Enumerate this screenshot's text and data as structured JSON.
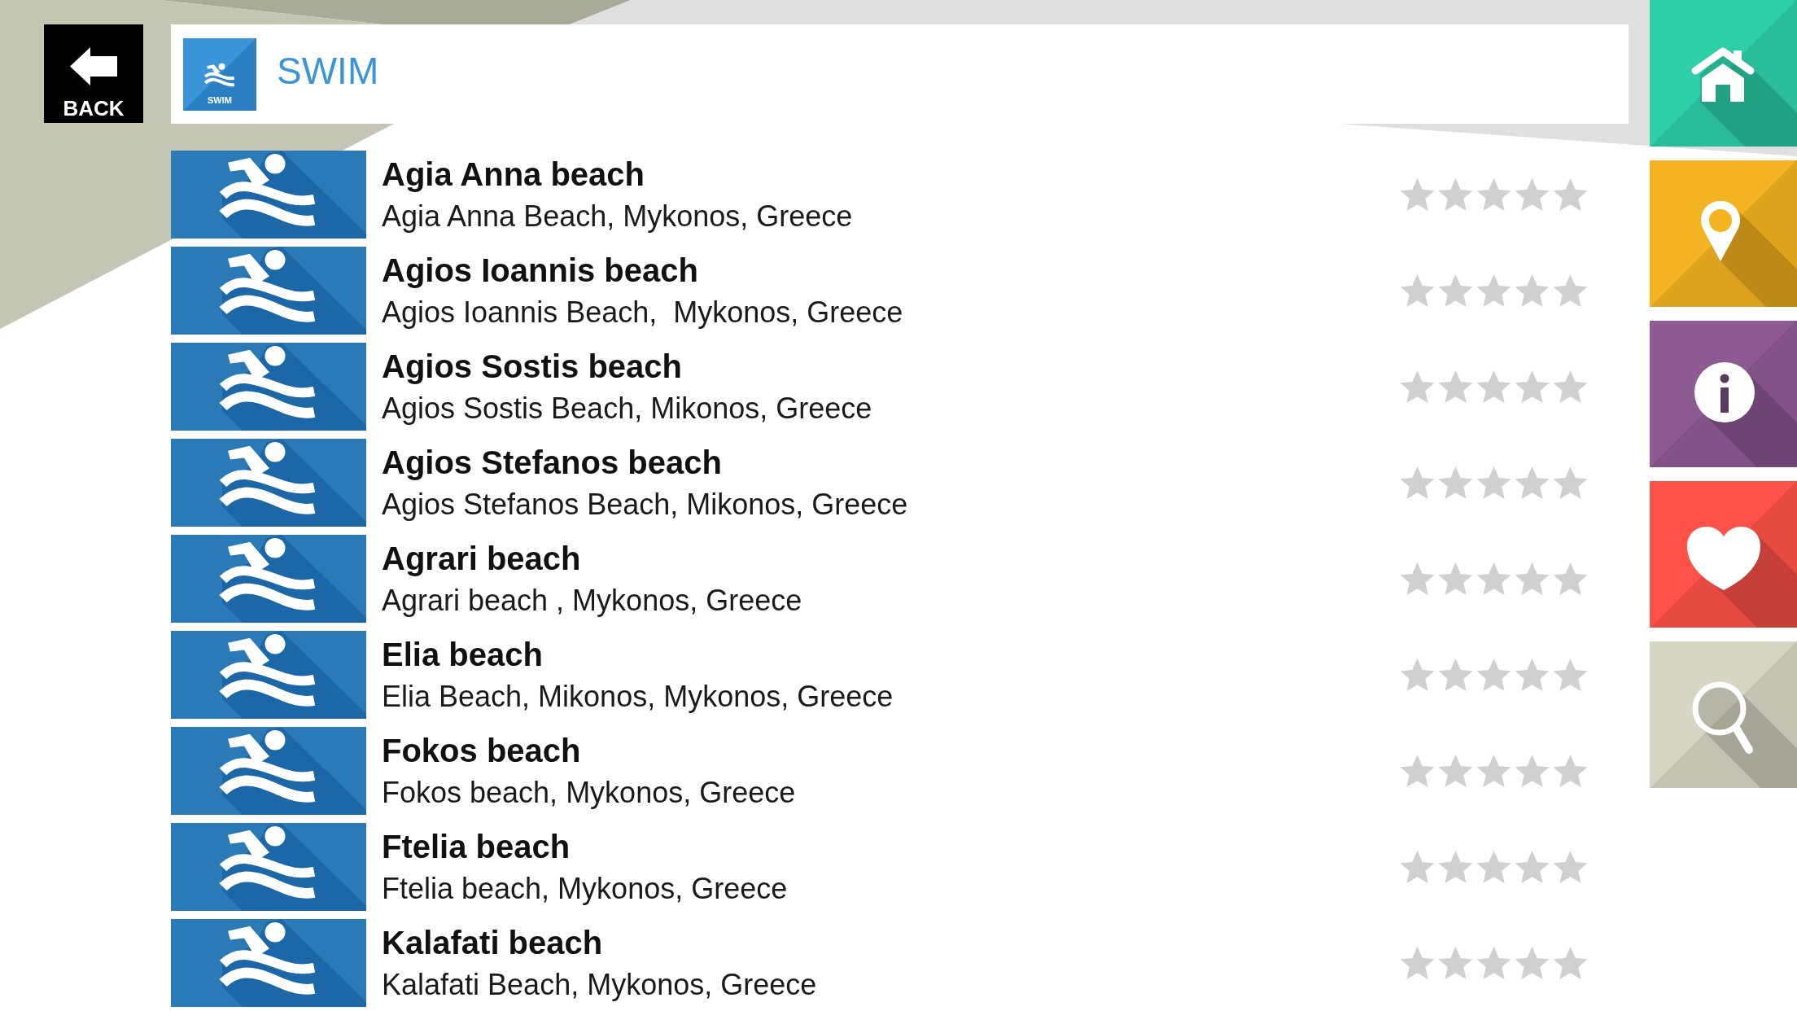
{
  "back_button": {
    "label": "BACK"
  },
  "header": {
    "icon_label": "SWIM",
    "title": "SWIM"
  },
  "places": [
    {
      "name": "Agia Anna beach",
      "address": "Agia Anna Beach, Mykonos, Greece",
      "stars": 0
    },
    {
      "name": "Agios Ioannis beach",
      "address": "Agios Ioannis Beach,  Mykonos, Greece",
      "stars": 0
    },
    {
      "name": "Agios Sostis beach",
      "address": "Agios Sostis Beach, Mikonos, Greece",
      "stars": 0
    },
    {
      "name": "Agios Stefanos beach",
      "address": "Agios Stefanos Beach, Mikonos, Greece",
      "stars": 0
    },
    {
      "name": "Agrari beach",
      "address": "Agrari beach , Mykonos, Greece",
      "stars": 0
    },
    {
      "name": "Elia beach",
      "address": "Elia Beach, Mikonos, Mykonos, Greece",
      "stars": 0
    },
    {
      "name": "Fokos beach",
      "address": "Fokos beach, Mykonos, Greece",
      "stars": 0
    },
    {
      "name": "Ftelia beach",
      "address": "Ftelia beach, Mykonos, Greece",
      "stars": 0
    },
    {
      "name": "Kalafati beach",
      "address": "Kalafati Beach, Mykonos, Greece",
      "stars": 0
    }
  ],
  "nav": [
    {
      "kind": "home",
      "color": "#2dcfa9"
    },
    {
      "kind": "location",
      "color": "#f4b320"
    },
    {
      "kind": "info",
      "color": "#8e5a93"
    },
    {
      "kind": "favorites",
      "color": "#fe5147"
    },
    {
      "kind": "search",
      "color": "#d7d6c4"
    }
  ]
}
